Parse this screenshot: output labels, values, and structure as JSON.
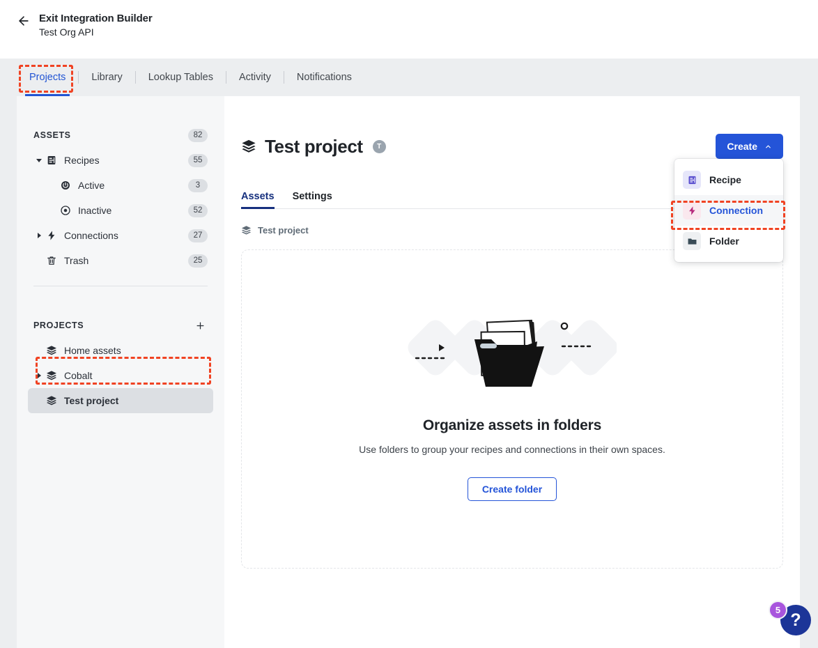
{
  "header": {
    "back_icon": "arrow-left-icon",
    "title": "Exit Integration Builder",
    "subtitle": "Test Org API"
  },
  "nav_tabs": [
    {
      "label": "Projects",
      "active": true
    },
    {
      "label": "Library",
      "active": false
    },
    {
      "label": "Lookup Tables",
      "active": false
    },
    {
      "label": "Activity",
      "active": false
    },
    {
      "label": "Notifications",
      "active": false
    }
  ],
  "sidebar": {
    "assets": {
      "title": "ASSETS",
      "count": "82",
      "items": [
        {
          "label": "Recipes",
          "count": "55",
          "icon": "recipe-icon",
          "caret": "expanded",
          "indent": 0
        },
        {
          "label": "Active",
          "count": "3",
          "icon": "power-on-icon",
          "caret": "none",
          "indent": 1
        },
        {
          "label": "Inactive",
          "count": "52",
          "icon": "power-off-icon",
          "caret": "none",
          "indent": 1
        },
        {
          "label": "Connections",
          "count": "27",
          "icon": "bolt-icon",
          "caret": "collapsed",
          "indent": 0
        },
        {
          "label": "Trash",
          "count": "25",
          "icon": "trash-icon",
          "caret": "none",
          "indent": 0
        }
      ]
    },
    "projects": {
      "title": "PROJECTS",
      "add_icon": "plus-icon",
      "items": [
        {
          "label": "Home assets",
          "icon": "stack-icon",
          "caret": "none",
          "selected": false
        },
        {
          "label": "Cobalt",
          "icon": "stack-icon",
          "caret": "collapsed",
          "selected": false
        },
        {
          "label": "Test project",
          "icon": "stack-icon",
          "caret": "none",
          "selected": true
        }
      ]
    }
  },
  "main": {
    "project_icon": "stack-icon",
    "project_title": "Test project",
    "avatar_initial": "T",
    "create_button": {
      "label": "Create",
      "icon": "chevron-up-icon"
    },
    "create_menu": [
      {
        "label": "Recipe",
        "icon": "recipe-icon",
        "hovered": false
      },
      {
        "label": "Connection",
        "icon": "bolt-icon",
        "hovered": true
      },
      {
        "label": "Folder",
        "icon": "folder-icon",
        "hovered": false
      }
    ],
    "sub_tabs": [
      {
        "label": "Assets",
        "active": true
      },
      {
        "label": "Settings",
        "active": false
      }
    ],
    "breadcrumb": {
      "icon": "stack-icon",
      "label": "Test project"
    },
    "empty_state": {
      "illustration": "open-folder-with-documents-illustration",
      "title": "Organize assets in folders",
      "subtitle": "Use folders to group your recipes and connections in their own spaces.",
      "button_label": "Create folder"
    }
  },
  "help": {
    "icon": "question-mark-icon",
    "badge_count": "5"
  },
  "colors": {
    "accent_blue": "#2454d8",
    "tab_blue": "#2255d4",
    "subtab_navy": "#16307e",
    "annotation_red": "#f04323",
    "badge_purple": "#a855dd",
    "help_navy": "#1c3598"
  }
}
